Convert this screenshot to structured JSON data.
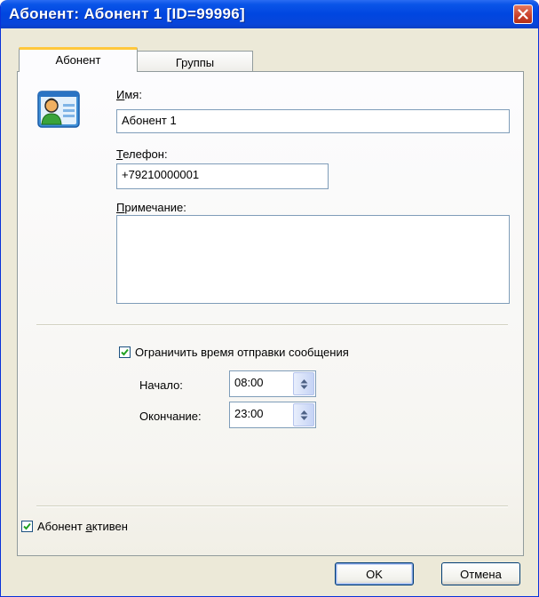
{
  "window": {
    "title": "Абонент: Абонент 1 [ID=99996]"
  },
  "tabs": [
    {
      "label": "Абонент",
      "active": true
    },
    {
      "label": "Группы",
      "active": false
    }
  ],
  "form": {
    "name_label_hotkey": "И",
    "name_label_rest": "мя:",
    "name_value": "Абонент 1",
    "phone_label_hotkey": "Т",
    "phone_label_rest": "елефон:",
    "phone_value": "+79210000001",
    "note_label_hotkey": "П",
    "note_label_rest": "римечание:",
    "note_value": ""
  },
  "schedule": {
    "limit_label": "Ограничить время отправки сообщения",
    "limit_checked": true,
    "start_label": "Начало:",
    "start_value": "08:00",
    "end_label": "Окончание:",
    "end_value": "23:00"
  },
  "active": {
    "label_before": "Абонент ",
    "label_hotkey": "а",
    "label_after": "ктивен",
    "checked": true
  },
  "buttons": {
    "ok_label": "OK",
    "cancel_label": "Отмена"
  },
  "colors": {
    "title_bar": "#0046e0",
    "close_button": "#c9402a",
    "active_tab_accent": "#ffc83c",
    "checkbox_mark": "#21a121"
  },
  "icons": {
    "close": "close-icon",
    "contact_card": "contact-card-icon",
    "checkmark": "checkmark-icon",
    "spin_up": "spin-up-icon",
    "spin_down": "spin-down-icon"
  }
}
